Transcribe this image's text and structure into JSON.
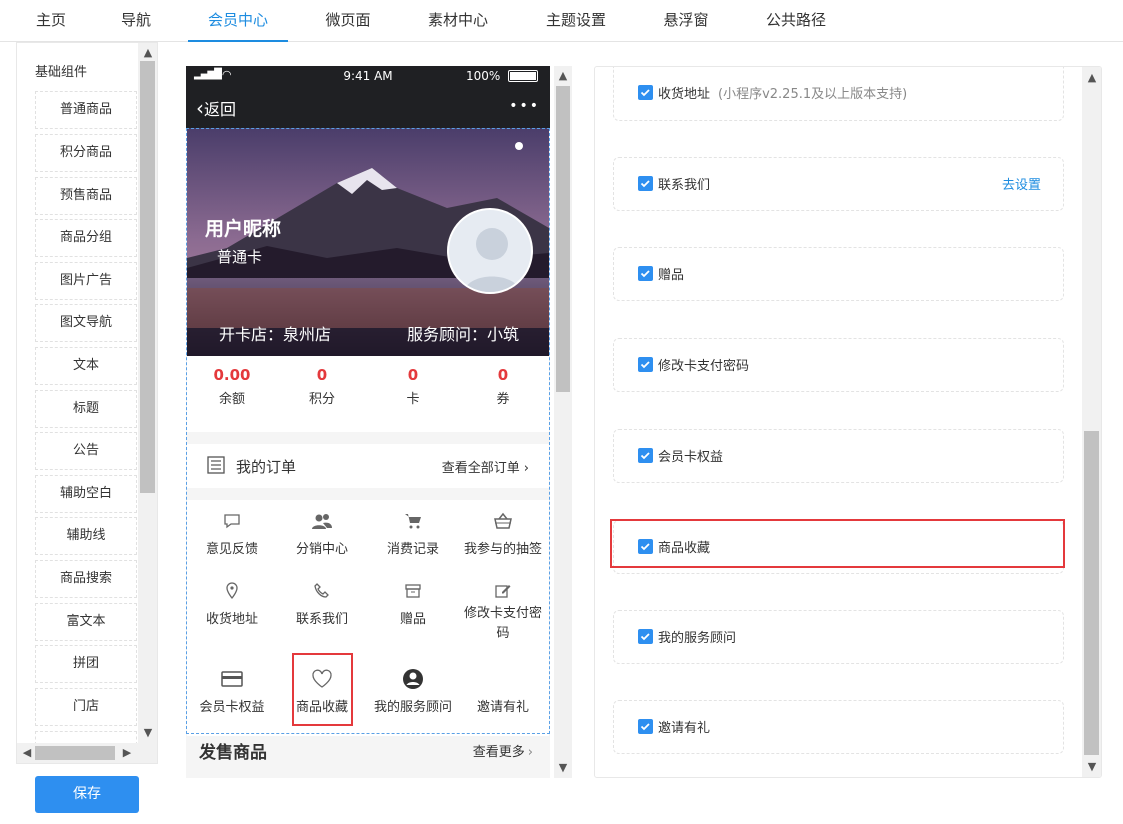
{
  "nav": {
    "tabs": [
      "主页",
      "导航",
      "会员中心",
      "微页面",
      "素材中心",
      "主题设置",
      "悬浮窗",
      "公共路径"
    ],
    "active_index": 2
  },
  "left": {
    "group_title": "基础组件",
    "items": [
      "普通商品",
      "积分商品",
      "预售商品",
      "商品分组",
      "图片广告",
      "图文导航",
      "文本",
      "标题",
      "公告",
      "辅助空白",
      "辅助线",
      "商品搜索",
      "富文本",
      "拼团",
      "门店"
    ],
    "save_label": "保存"
  },
  "phone": {
    "status": {
      "time": "9:41 AM",
      "battery": "100%"
    },
    "back_label": "返回",
    "more_label": "•••",
    "profile": {
      "nickname": "用户昵称",
      "card_level": "普通卡",
      "store": "开卡店：泉州店",
      "advisor": "服务顾问：小筑"
    },
    "stats": [
      {
        "value": "0.00",
        "label": "余额"
      },
      {
        "value": "0",
        "label": "积分"
      },
      {
        "value": "0",
        "label": "卡"
      },
      {
        "value": "0",
        "label": "券"
      }
    ],
    "orders": {
      "title": "我的订单",
      "link": "查看全部订单"
    },
    "grid": [
      {
        "label": "意见反馈",
        "icon": "chat-bubble-icon"
      },
      {
        "label": "分销中心",
        "icon": "users-icon"
      },
      {
        "label": "消费记录",
        "icon": "cart-icon"
      },
      {
        "label": "我参与的抽签",
        "icon": "basket-icon"
      },
      {
        "label": "收货地址",
        "icon": "location-pin-icon"
      },
      {
        "label": "联系我们",
        "icon": "phone-icon"
      },
      {
        "label": "赠品",
        "icon": "archive-box-icon"
      },
      {
        "label": "修改卡支付密码",
        "icon": "edit-icon"
      },
      {
        "label": "会员卡权益",
        "icon": "card-icon"
      },
      {
        "label": "商品收藏",
        "icon": "heart-icon"
      },
      {
        "label": "我的服务顾问",
        "icon": "user-circle-icon"
      },
      {
        "label": "邀请有礼",
        "icon": ""
      }
    ],
    "sale": {
      "title": "发售商品",
      "more": "查看更多"
    }
  },
  "settings": [
    {
      "label": "收货地址",
      "note": "(小程序v2.25.1及以上版本支持)",
      "link": "",
      "checked": true
    },
    {
      "label": "联系我们",
      "note": "",
      "link": "去设置",
      "checked": true
    },
    {
      "label": "赠品",
      "note": "",
      "link": "",
      "checked": true
    },
    {
      "label": "修改卡支付密码",
      "note": "",
      "link": "",
      "checked": true
    },
    {
      "label": "会员卡权益",
      "note": "",
      "link": "",
      "checked": true
    },
    {
      "label": "商品收藏",
      "note": "",
      "link": "",
      "checked": true
    },
    {
      "label": "我的服务顾问",
      "note": "",
      "link": "",
      "checked": true
    },
    {
      "label": "邀请有礼",
      "note": "",
      "link": "",
      "checked": true
    }
  ],
  "colors": {
    "accent": "#1d8ce0",
    "button": "#2e8ff0",
    "price_red": "#e4393c",
    "highlight": "#e4393c"
  }
}
